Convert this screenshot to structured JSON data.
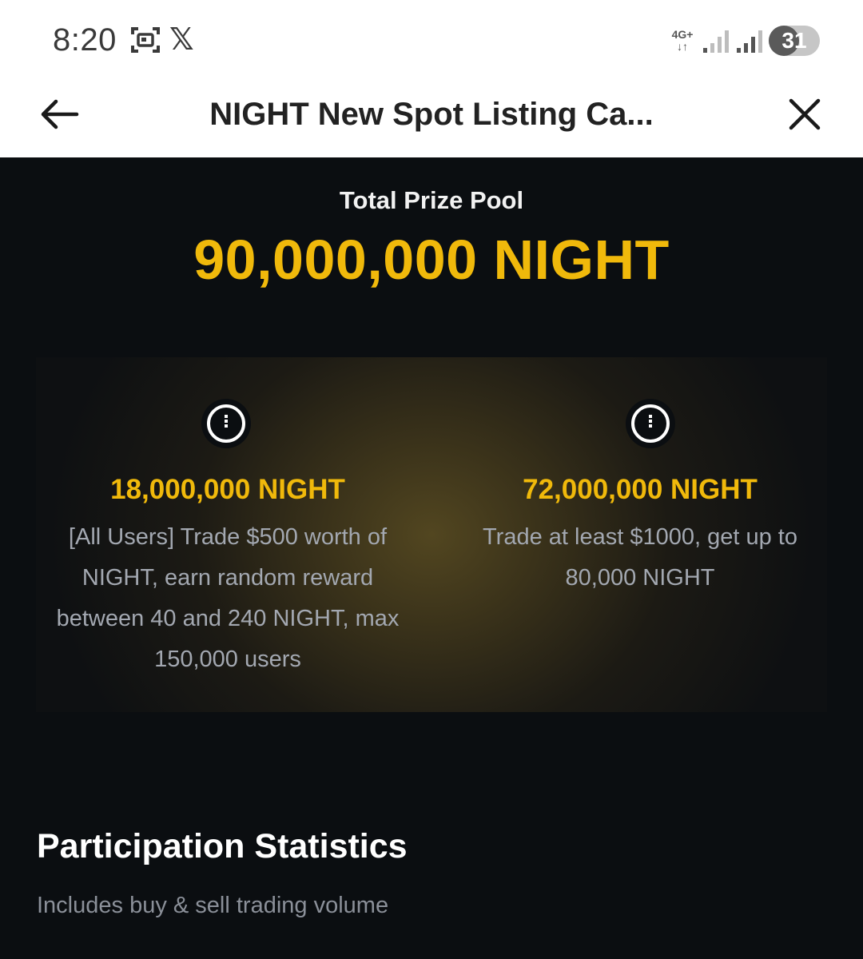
{
  "status_bar": {
    "time": "8:20",
    "network": "4G+",
    "network_arrows": "↓↑",
    "battery": "31",
    "battery_level": 0.31,
    "icons": [
      "screenshot-icon",
      "x-logo-icon",
      "signal-icon",
      "signal-icon",
      "battery-icon"
    ]
  },
  "header": {
    "title": "NIGHT New Spot Listing Ca...",
    "icons": [
      "back-arrow-icon",
      "close-icon"
    ]
  },
  "prize": {
    "label": "Total Prize Pool",
    "amount": "90,000,000 NIGHT"
  },
  "rewards": [
    {
      "amount": "18,000,000 NIGHT",
      "description": "[All Users] Trade $500 worth of NIGHT, earn random reward between 40 and 240 NIGHT, max 150,000 users",
      "icon": "info-icon"
    },
    {
      "amount": "72,000,000 NIGHT",
      "description": "Trade at least $1000, get up to 80,000 NIGHT",
      "icon": "info-icon"
    }
  ],
  "statistics": {
    "title": "Participation Statistics",
    "subtitle": "Includes buy & sell trading volume"
  },
  "colors": {
    "accent": "#f0b90b",
    "background": "#0b0e11",
    "muted_text": "#a3a8b1"
  }
}
